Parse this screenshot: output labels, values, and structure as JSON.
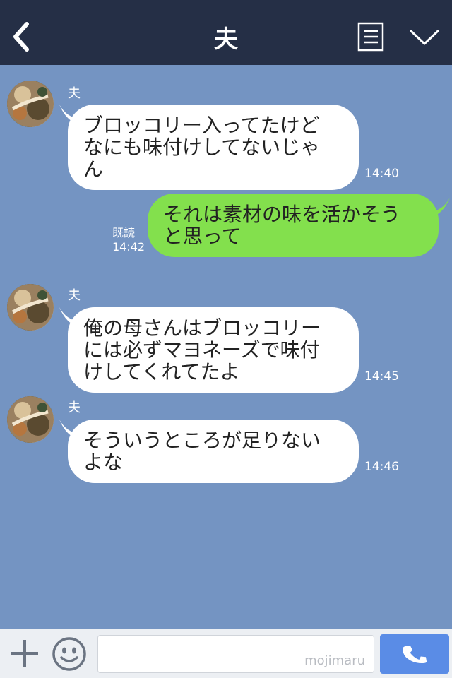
{
  "header": {
    "title": "夫",
    "back_icon": "chevron-left-icon",
    "notes_icon": "notes-icon",
    "menu_icon": "chevron-down-icon"
  },
  "messages": [
    {
      "direction": "in",
      "sender": "夫",
      "lines": [
        "ブロッコリー入ってたけど",
        "なにも味付けしてないじゃ",
        "ん"
      ],
      "time": "14:40"
    },
    {
      "direction": "out",
      "lines": [
        "それは素材の味を活かそう",
        "と思って"
      ],
      "read_label": "既読",
      "time": "14:42"
    },
    {
      "direction": "in",
      "sender": "夫",
      "lines": [
        "俺の母さんはブロッコリー",
        "には必ずマヨネーズで味付",
        "けしてくれてたよ"
      ],
      "time": "14:45"
    },
    {
      "direction": "in",
      "sender": "夫",
      "lines": [
        "そういうところが足りない",
        "よな"
      ],
      "time": "14:46"
    }
  ],
  "input_bar": {
    "plus_icon": "plus-icon",
    "emoji_icon": "smiley-icon",
    "input_value": "",
    "watermark": "mojimaru",
    "call_icon": "phone-icon"
  },
  "colors": {
    "header_bg": "#252f46",
    "chat_bg": "#7494c2",
    "incoming_bubble": "#ffffff",
    "outgoing_bubble": "#83e04d",
    "call_button": "#5a8ce6"
  }
}
